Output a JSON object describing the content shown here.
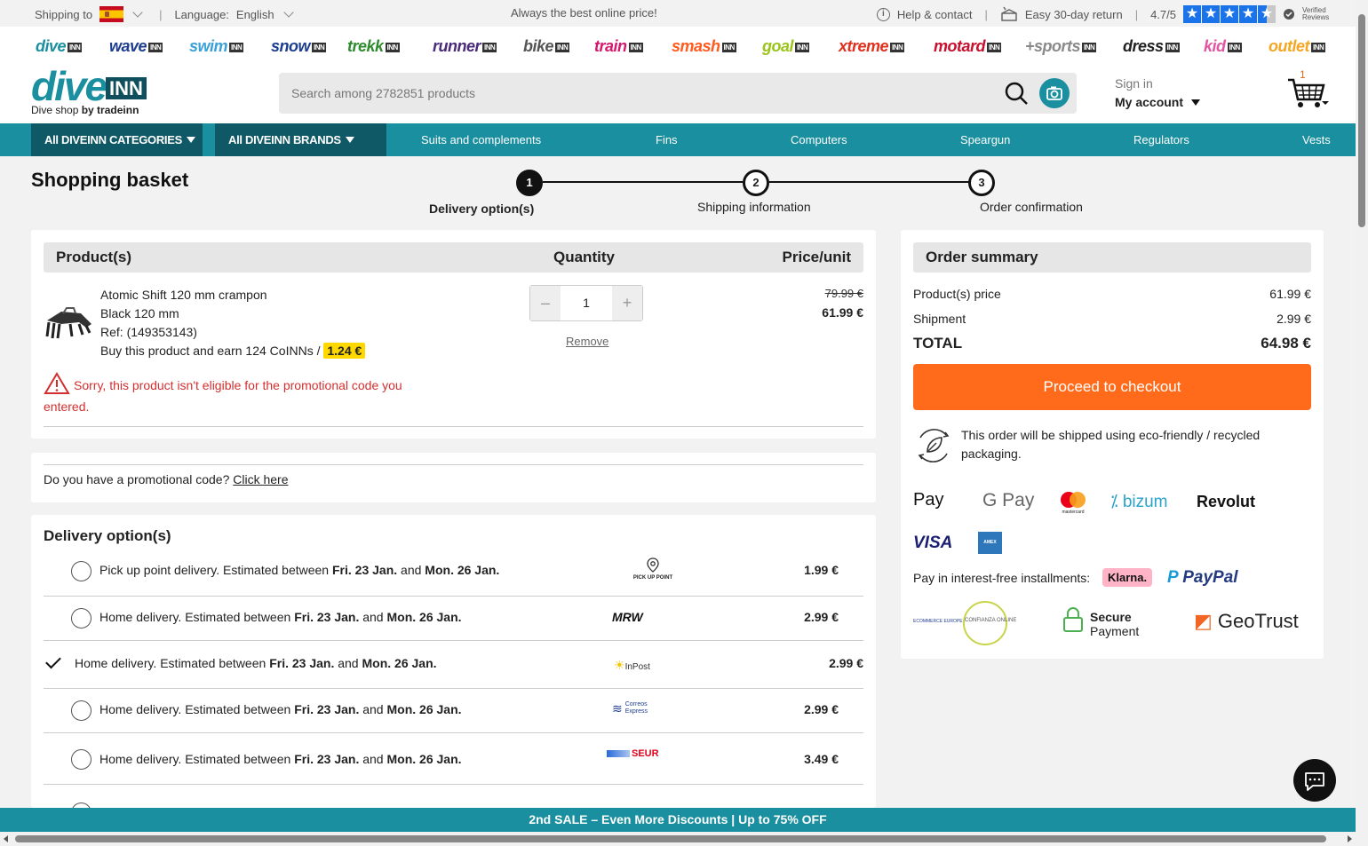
{
  "topbar": {
    "shipping_label": "Shipping to",
    "language_label": "Language:",
    "language_value": "English",
    "tagline": "Always the best online price!",
    "help": "Help & contact",
    "returns": "Easy 30-day return",
    "rating": "4.7/5",
    "verified": "Verified Reviews"
  },
  "brands": [
    {
      "name": "dive",
      "color": "#1a8fa0"
    },
    {
      "name": "wave",
      "color": "#1d3d8f"
    },
    {
      "name": "swim",
      "color": "#3aa0d8"
    },
    {
      "name": "snow",
      "color": "#1d3d8f"
    },
    {
      "name": "trekk",
      "color": "#2e8b2e"
    },
    {
      "name": "runner",
      "color": "#4a2a7a"
    },
    {
      "name": "bike",
      "color": "#555555"
    },
    {
      "name": "train",
      "color": "#d6196e"
    },
    {
      "name": "smash",
      "color": "#ff5a1f"
    },
    {
      "name": "goal",
      "color": "#9bc41a"
    },
    {
      "name": "xtreme",
      "color": "#e0301e"
    },
    {
      "name": "motard",
      "color": "#c8102e"
    },
    {
      "name": "+sports",
      "color": "#8a8a8a"
    },
    {
      "name": "dress",
      "color": "#222222"
    },
    {
      "name": "kid",
      "color": "#e056a0"
    },
    {
      "name": "outlet",
      "color": "#f5a623"
    }
  ],
  "brand_suffix": "INN",
  "header": {
    "logo_main": "dive",
    "logo_suffix": "INN",
    "tagline_prefix": "Dive shop",
    "tagline_by": "by tradeinn",
    "search_placeholder": "Search among 2782851 products",
    "signin": "Sign in",
    "account": "My account",
    "cart_count": "1"
  },
  "nav": {
    "categories": "All DIVEINN CATEGORIES",
    "brands": "All DIVEINN BRANDS",
    "links": [
      "Suits and complements",
      "Fins",
      "Computers",
      "Speargun",
      "Regulators",
      "Vests"
    ]
  },
  "page": {
    "title": "Shopping basket",
    "steps": [
      {
        "num": "1",
        "label": "Delivery option(s)"
      },
      {
        "num": "2",
        "label": "Shipping information"
      },
      {
        "num": "3",
        "label": "Order confirmation"
      }
    ]
  },
  "basket": {
    "col_product": "Product(s)",
    "col_quantity": "Quantity",
    "col_price": "Price/unit",
    "item": {
      "name": "Atomic Shift 120 mm crampon",
      "variant": "Black 120 mm",
      "ref": "Ref: (149353143)",
      "coins_text": "Buy this product and earn 124 CoINNs /",
      "coins_value": "1.24 €",
      "quantity": "1",
      "minus": "–",
      "plus": "+",
      "remove": "Remove",
      "old_price": "79.99 €",
      "price": "61.99 €"
    },
    "warning": "Sorry, this product isn't eligible for the promotional code you entered."
  },
  "promo": {
    "question": "Do you have a promotional code?",
    "link": "Click here"
  },
  "delivery": {
    "title": "Delivery option(s)",
    "options": [
      {
        "type": "Pick up point delivery. Estimated between",
        "from": "Fri. 23 Jan.",
        "and": "and",
        "to": "Mon. 26 Jan.",
        "carrier": "PICK UP POINT",
        "price": "1.99 €",
        "selected": false
      },
      {
        "type": "Home delivery. Estimated between",
        "from": "Fri. 23 Jan.",
        "and": "and",
        "to": "Mon. 26 Jan.",
        "carrier": "MRW",
        "price": "2.99 €",
        "selected": false
      },
      {
        "type": "Home delivery. Estimated between",
        "from": "Fri. 23 Jan.",
        "and": "and",
        "to": "Mon. 26 Jan.",
        "carrier": "InPost",
        "price": "2.99 €",
        "selected": true
      },
      {
        "type": "Home delivery. Estimated between",
        "from": "Fri. 23 Jan.",
        "and": "and",
        "to": "Mon. 26 Jan.",
        "carrier": "Correos Express",
        "price": "2.99 €",
        "selected": false
      },
      {
        "type": "Home delivery. Estimated between",
        "from": "Fri. 23 Jan.",
        "and": "and",
        "to": "Mon. 26 Jan.",
        "carrier": "SEUR",
        "price": "3.49 €",
        "selected": false
      }
    ]
  },
  "summary": {
    "title": "Order summary",
    "product_price_label": "Product(s) price",
    "product_price": "61.99 €",
    "shipment_label": "Shipment",
    "shipment": "2.99 €",
    "total_label": "TOTAL",
    "total": "64.98 €",
    "checkout": "Proceed to checkout",
    "eco": "This order will be shipped using eco-friendly / recycled packaging.",
    "payments": [
      "Pay",
      "G Pay",
      "mastercard",
      "bizum",
      "Revolut",
      "VISA",
      "AMEX"
    ],
    "installments_label": "Pay in interest-free installments:",
    "klarna": "Klarna.",
    "paypal": "PayPal",
    "secure_title": "Secure",
    "secure_sub": "Payment",
    "geotrust": "GeoTrust",
    "confianza": "CONFIANZA ONLINE",
    "ecommerce": "ECOMMERCE EUROPE"
  },
  "banner": "2nd SALE – Even More Discounts | Up to 75% OFF"
}
